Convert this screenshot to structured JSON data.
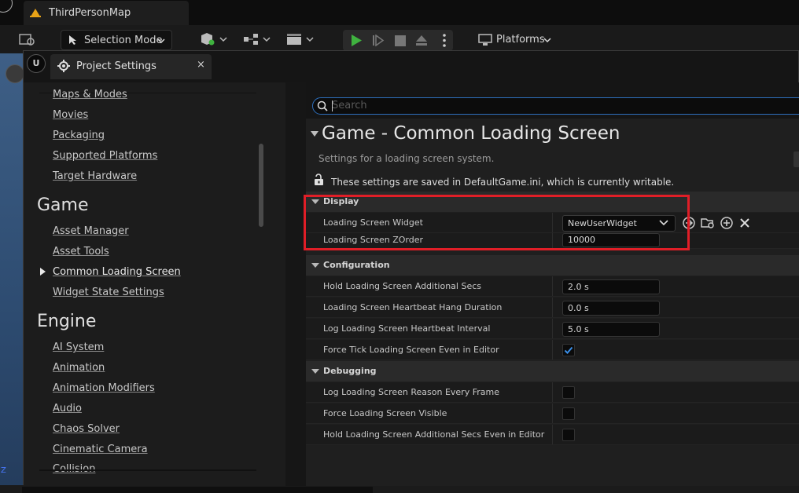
{
  "editor": {
    "map_tab": "ThirdPersonMap",
    "selection_mode": "Selection Mode",
    "platforms": "Platforms",
    "axis_label": "Z"
  },
  "window": {
    "title": "Project Settings",
    "close": "×"
  },
  "nav": {
    "items_top": [
      "Maps & Modes",
      "Movies",
      "Packaging",
      "Supported Platforms",
      "Target Hardware"
    ],
    "game_heading": "Game",
    "game_items": [
      "Asset Manager",
      "Asset Tools",
      "Common Loading Screen",
      "Widget State Settings"
    ],
    "engine_heading": "Engine",
    "engine_items": [
      "AI System",
      "Animation",
      "Animation Modifiers",
      "Audio",
      "Chaos Solver",
      "Cinematic Camera",
      "Collision"
    ]
  },
  "search": {
    "placeholder": "Search"
  },
  "page": {
    "title": "Game - Common Loading Screen",
    "description": "Settings for a loading screen system.",
    "saved_note": "These settings are saved in DefaultGame.ini, which is currently writable."
  },
  "sections": {
    "display": {
      "label": "Display",
      "widget_label": "Loading Screen Widget",
      "widget_value": "NewUserWidget",
      "zorder_label": "Loading Screen ZOrder",
      "zorder_value": "10000"
    },
    "configuration": {
      "label": "Configuration",
      "rows": [
        {
          "name": "Hold Loading Screen Additional Secs",
          "value": "2.0 s"
        },
        {
          "name": "Loading Screen Heartbeat Hang Duration",
          "value": "0.0 s"
        },
        {
          "name": "Log Loading Screen Heartbeat Interval",
          "value": "5.0 s"
        },
        {
          "name": "Force Tick Loading Screen Even in Editor",
          "checked": true
        }
      ]
    },
    "debugging": {
      "label": "Debugging",
      "rows": [
        {
          "name": "Log Loading Screen Reason Every Frame",
          "checked": false
        },
        {
          "name": "Force Loading Screen Visible",
          "checked": false
        },
        {
          "name": "Hold Loading Screen Additional Secs Even in Editor",
          "checked": false
        }
      ]
    }
  },
  "colors": {
    "highlight_box": "#e01e27",
    "accent_blue": "#2d6fbd",
    "play_green": "#3fb23f"
  }
}
